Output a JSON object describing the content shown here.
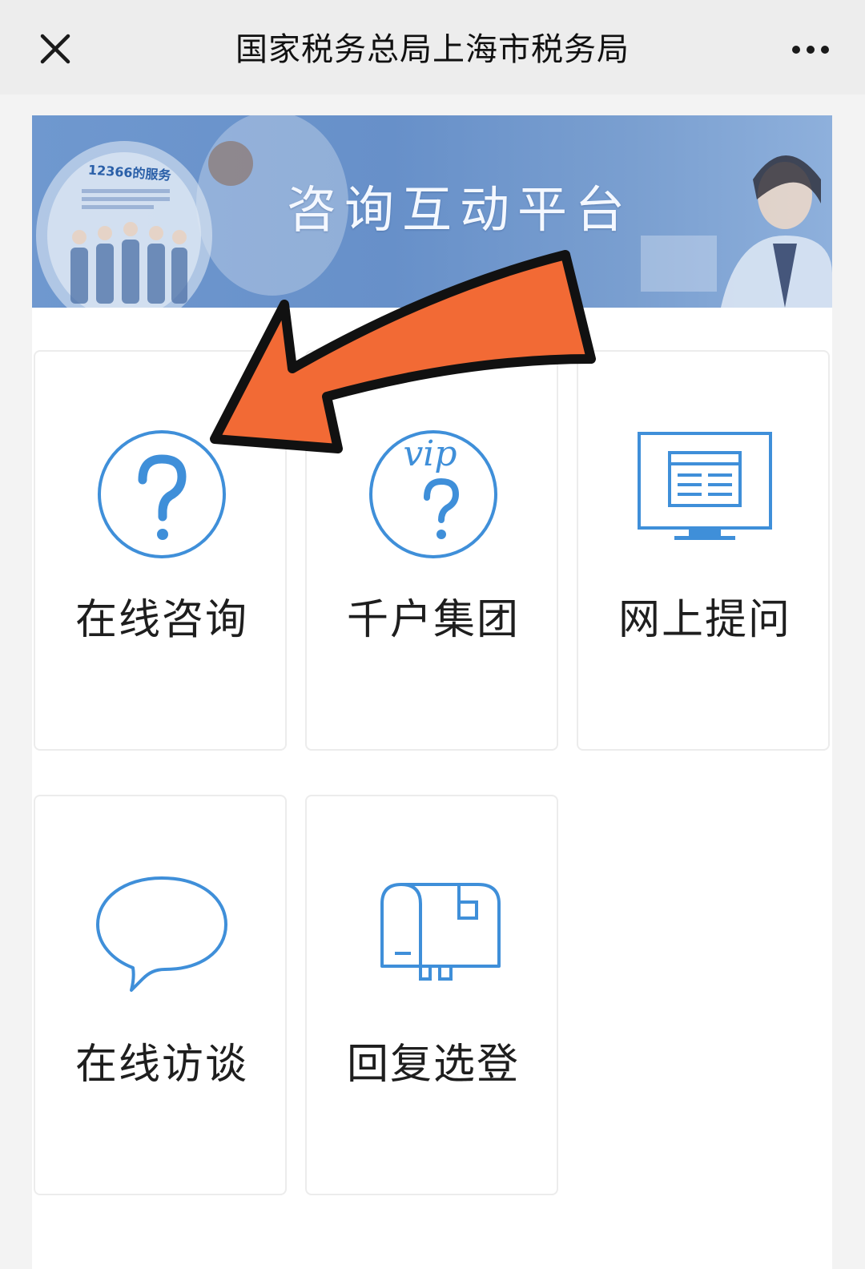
{
  "header": {
    "title": "国家税务总局上海市税务局",
    "close_icon": "close-icon",
    "more_icon": "more-horizontal-icon"
  },
  "banner": {
    "title": "咨询互动平台",
    "sign_text": "12366的服务"
  },
  "tiles": [
    {
      "label": "在线咨询",
      "icon": "question-circle-icon"
    },
    {
      "label": "千户集团",
      "icon": "vip-question-circle-icon"
    },
    {
      "label": "网上提问",
      "icon": "monitor-icon"
    },
    {
      "label": "在线访谈",
      "icon": "speech-bubble-icon"
    },
    {
      "label": "回复选登",
      "icon": "mailbox-icon"
    }
  ],
  "colors": {
    "accent_blue": "#3f8fd9",
    "arrow_orange": "#f26a35",
    "banner_blue": "#6f98cf"
  }
}
